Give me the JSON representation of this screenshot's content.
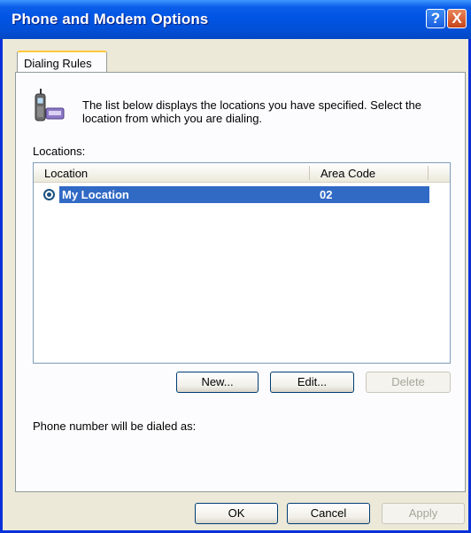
{
  "window": {
    "title": "Phone and Modem Options",
    "help_label": "?",
    "close_label": "X"
  },
  "tabs": [
    {
      "label": "Dialing Rules",
      "active": true
    }
  ],
  "dialing_rules": {
    "description": "The list below displays the locations you have specified. Select the location from which you are dialing.",
    "locations_label": "Locations:",
    "columns": [
      "Location",
      "Area Code"
    ],
    "rows": [
      {
        "location": "My Location",
        "area_code": "02",
        "selected": true
      }
    ],
    "buttons": {
      "new": "New...",
      "edit": "Edit...",
      "delete": "Delete"
    },
    "dialed_as_label": "Phone number will be dialed as:"
  },
  "footer": {
    "ok": "OK",
    "cancel": "Cancel",
    "apply": "Apply"
  },
  "icons": {
    "location": "phone-handset-icon"
  }
}
